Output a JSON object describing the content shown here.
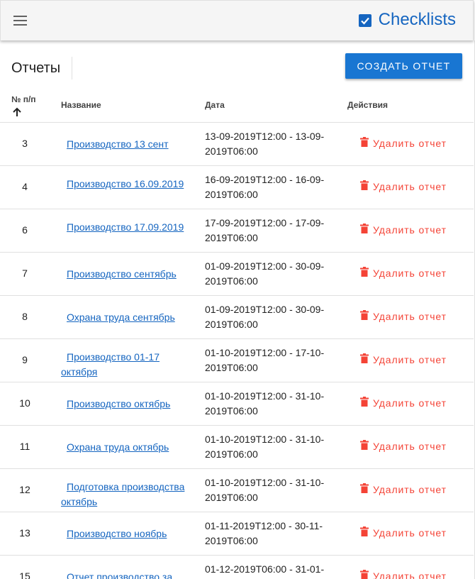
{
  "header": {
    "brand_title": "Checklists",
    "colors": {
      "brand": "#1565c0",
      "accent": "#1976d2",
      "danger": "#f44336"
    },
    "icons": {
      "menu": "menu-icon",
      "brand": "checkbox-checked-icon"
    }
  },
  "toolbar": {
    "title": "Отчеты",
    "create_label": "СОЗДАТЬ ОТЧЕТ"
  },
  "table": {
    "columns": {
      "num": "№ п/п",
      "name": "Название",
      "date": "Дата",
      "actions": "Действия"
    },
    "sort_icon": "arrow-up-icon",
    "delete_label": "Удалить отчет",
    "rows": [
      {
        "num": "3",
        "name": "Производство 13 сент",
        "date": "13-09-2019T12:00 - 13-09-2019T06:00"
      },
      {
        "num": "4",
        "name": "Производство 16.09.2019",
        "date": "16-09-2019T12:00 - 16-09-2019T06:00"
      },
      {
        "num": "6",
        "name": "Производство 17.09.2019",
        "date": "17-09-2019T12:00 - 17-09-2019T06:00"
      },
      {
        "num": "7",
        "name": "Производство сентябрь",
        "date": "01-09-2019T12:00 - 30-09-2019T06:00"
      },
      {
        "num": "8",
        "name": "Охрана труда сентябрь",
        "date": "01-09-2019T12:00 - 30-09-2019T06:00"
      },
      {
        "num": "9",
        "name": "Производство 01-17 октября",
        "date": "01-10-2019T12:00 - 17-10-2019T06:00"
      },
      {
        "num": "10",
        "name": "Производство октябрь",
        "date": "01-10-2019T12:00 - 31-10-2019T06:00"
      },
      {
        "num": "11",
        "name": "Охрана труда октябрь",
        "date": "01-10-2019T12:00 - 31-10-2019T06:00"
      },
      {
        "num": "12",
        "name": "Подготовка производства октябрь",
        "date": "01-10-2019T12:00 - 31-10-2019T06:00"
      },
      {
        "num": "13",
        "name": "Производство ноябрь",
        "date": "01-11-2019T12:00 - 30-11-2019T06:00"
      },
      {
        "num": "15",
        "name": "Отчет производство за",
        "date": "01-12-2019T06:00 - 31-01-"
      }
    ]
  }
}
